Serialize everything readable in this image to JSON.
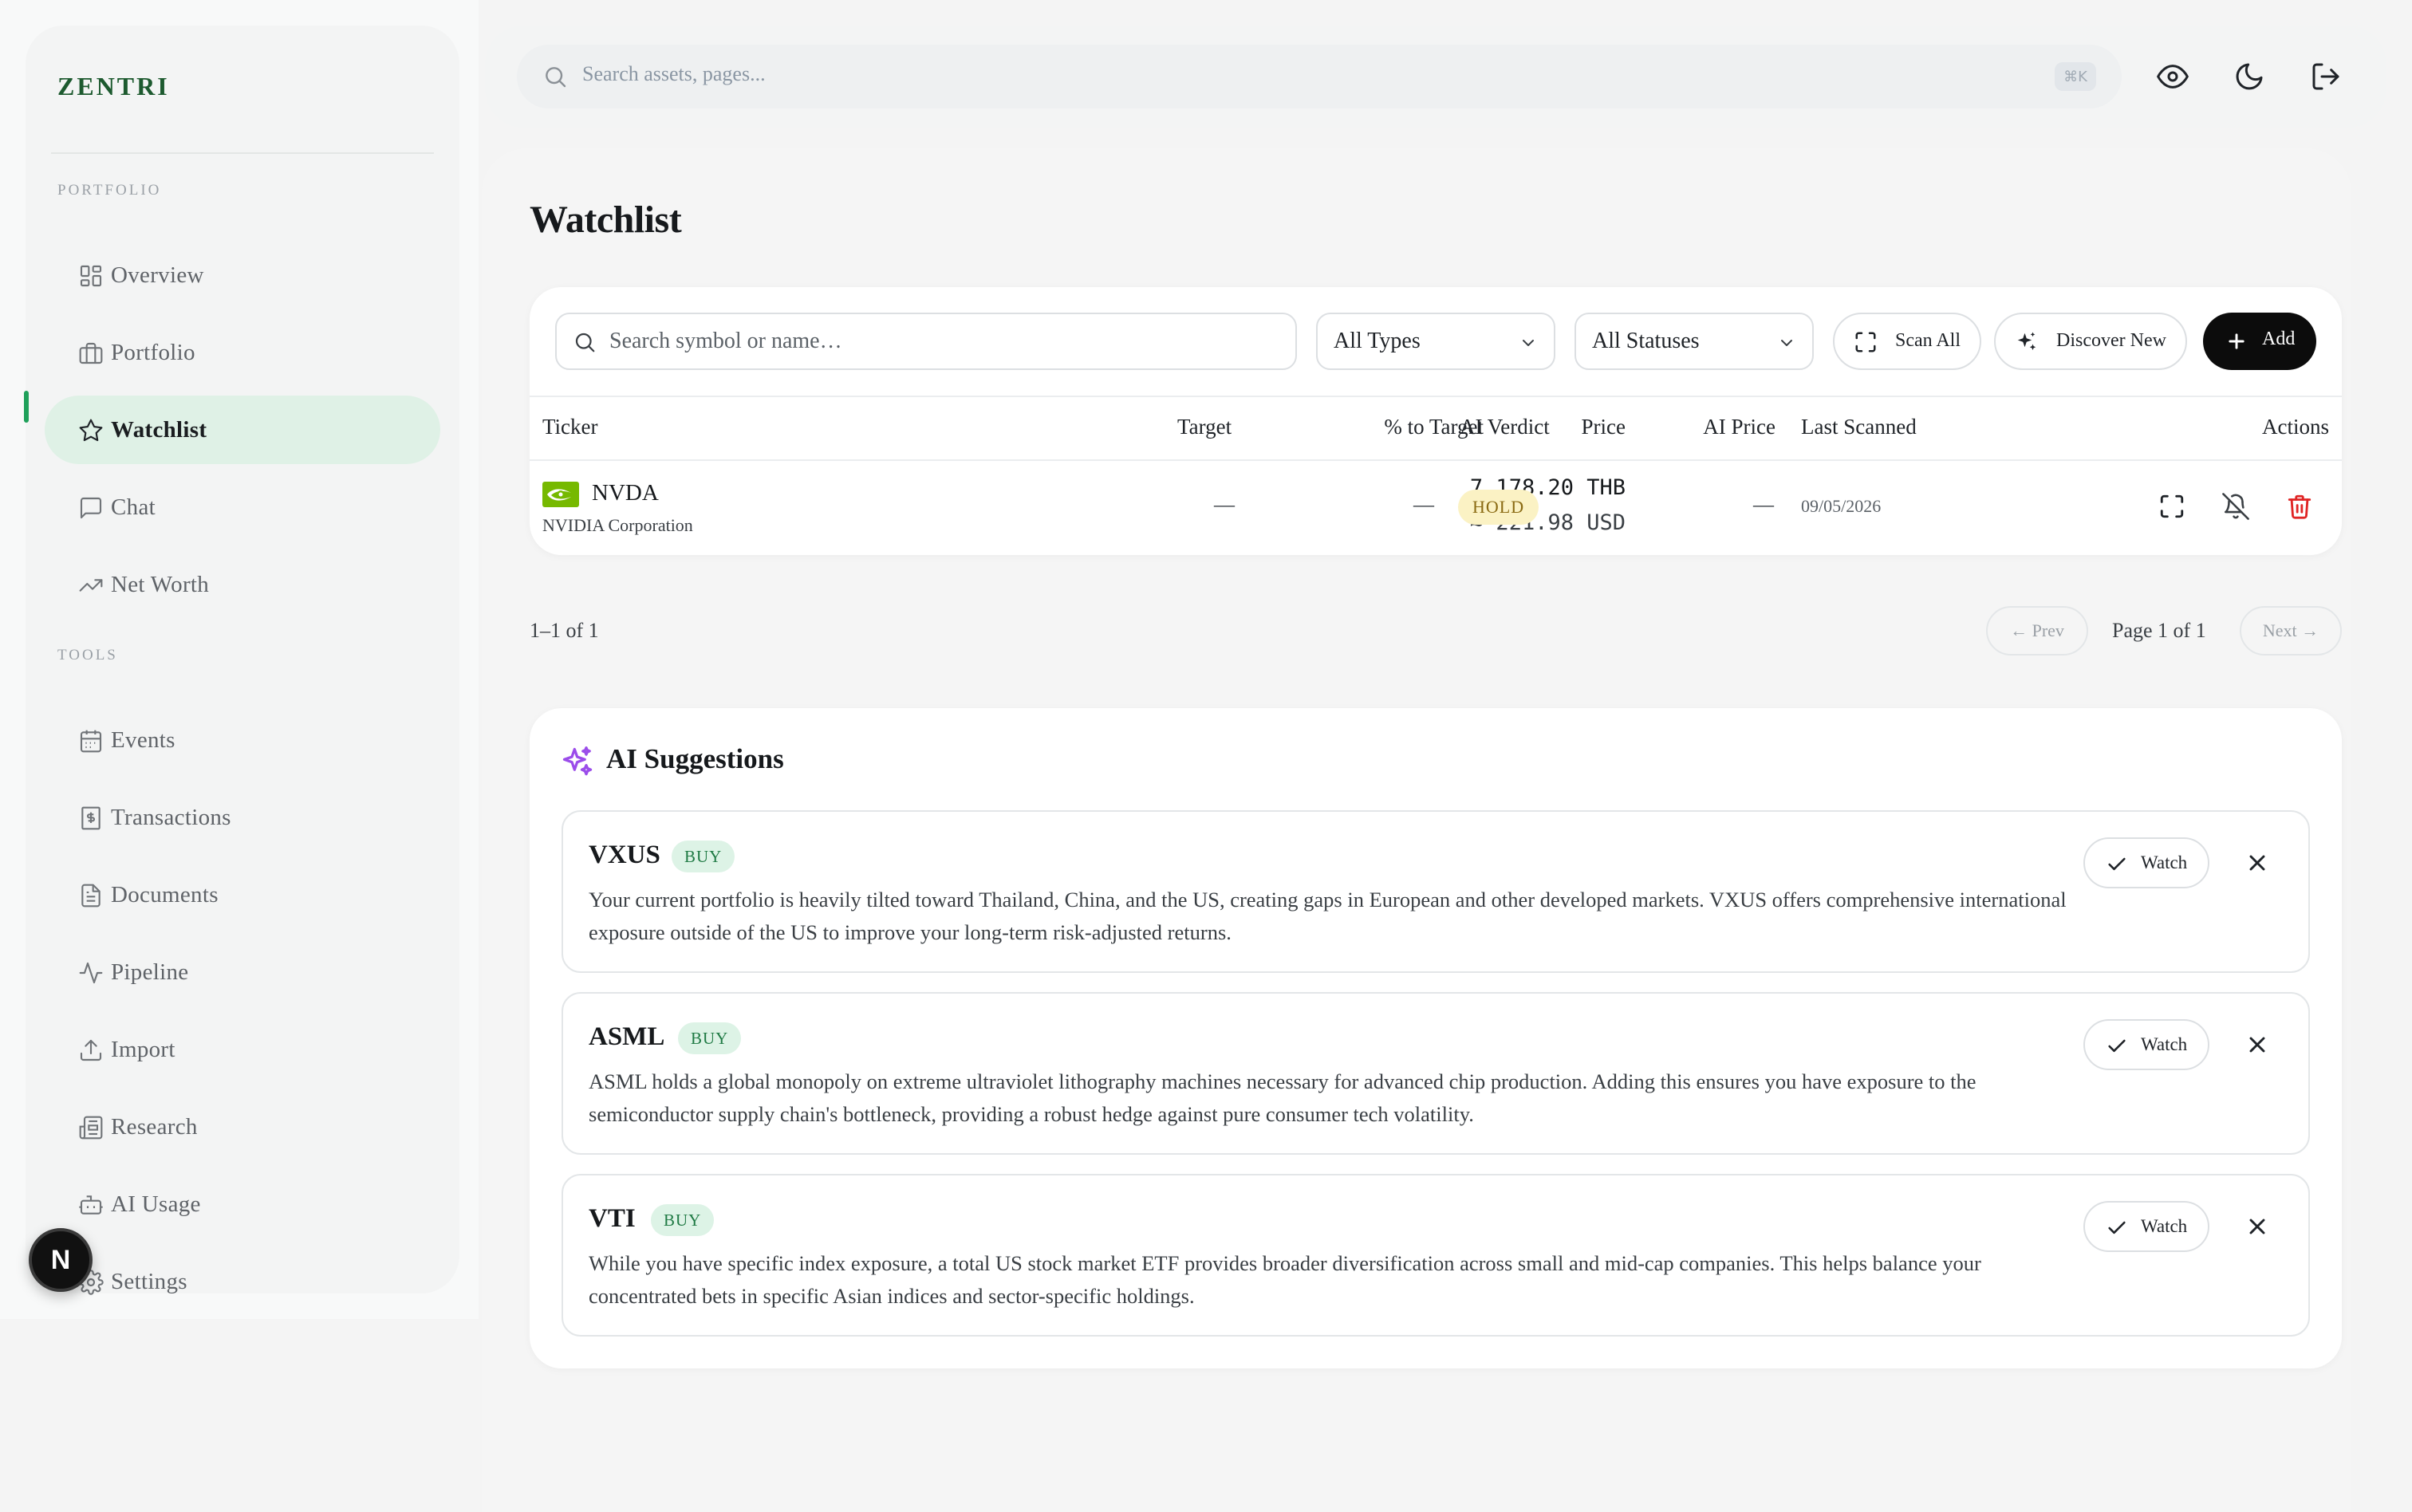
{
  "app": {
    "brand": "ZENTRI",
    "avatar_initial": "N"
  },
  "sidebar": {
    "sections": [
      {
        "label": "PORTFOLIO"
      },
      {
        "label": "TOOLS"
      }
    ],
    "items": [
      {
        "label": "Overview",
        "icon": "grid-icon"
      },
      {
        "label": "Portfolio",
        "icon": "briefcase-icon"
      },
      {
        "label": "Watchlist",
        "icon": "star-icon",
        "active": true
      },
      {
        "label": "Chat",
        "icon": "chat-icon"
      },
      {
        "label": "Net Worth",
        "icon": "trending-up-icon"
      },
      {
        "label": "Events",
        "icon": "calendar-icon"
      },
      {
        "label": "Transactions",
        "icon": "receipt-icon"
      },
      {
        "label": "Documents",
        "icon": "document-icon"
      },
      {
        "label": "Pipeline",
        "icon": "activity-icon"
      },
      {
        "label": "Import",
        "icon": "upload-icon"
      },
      {
        "label": "Research",
        "icon": "newspaper-icon"
      },
      {
        "label": "AI Usage",
        "icon": "bot-icon"
      },
      {
        "label": "Settings",
        "icon": "gear-icon"
      }
    ]
  },
  "topbar": {
    "search_placeholder": "Search assets, pages...",
    "shortcut": "⌘K"
  },
  "page": {
    "title": "Watchlist"
  },
  "filters": {
    "search_placeholder": "Search symbol or name…",
    "type_select": "All Types",
    "status_select": "All Statuses",
    "scan_all": "Scan All",
    "discover_new": "Discover New",
    "add": "Add"
  },
  "table": {
    "headers": {
      "ticker": "Ticker",
      "price": "Price",
      "target": "Target",
      "pct_to_target": "% to Target",
      "ai_verdict": "AI Verdict",
      "ai_price": "AI Price",
      "last_scanned": "Last Scanned",
      "actions": "Actions"
    },
    "rows": [
      {
        "ticker": "NVDA",
        "name": "NVIDIA Corporation",
        "price": "7,178.20 THB",
        "price_usd": "≈ 221.98 USD",
        "target": "—",
        "pct_to_target": "—",
        "ai_verdict": "HOLD",
        "ai_price": "—",
        "last_scanned": "09/05/2026"
      }
    ]
  },
  "pagination": {
    "range": "1–1 of 1",
    "prev": "← Prev",
    "page": "Page 1 of 1",
    "next": "Next →"
  },
  "ai_suggestions": {
    "title": "AI Suggestions",
    "watch_label": "Watch",
    "items": [
      {
        "symbol": "VXUS",
        "action": "BUY",
        "description": "Your current portfolio is heavily tilted toward Thailand, China, and the US, creating gaps in European and other developed markets. VXUS offers comprehensive international exposure outside of the US to improve your long-term risk-adjusted returns."
      },
      {
        "symbol": "ASML",
        "action": "BUY",
        "description": "ASML holds a global monopoly on extreme ultraviolet lithography machines necessary for advanced chip production. Adding this ensures you have exposure to the semiconductor supply chain's bottleneck, providing a robust hedge against pure consumer tech volatility."
      },
      {
        "symbol": "VTI",
        "action": "BUY",
        "description": "While you have specific index exposure, a total US stock market ETF provides broader diversification across small and mid-cap companies. This helps balance your concentrated bets in specific Asian indices and sector-specific holdings."
      }
    ]
  },
  "colors": {
    "brand": "#1d5a2f",
    "active_nav_bg": "#dff1e6",
    "active_bar": "#1fa05a",
    "hold_badge_bg": "#fbf2c4",
    "buy_badge_bg": "#ddf3e6",
    "delete": "#e02424",
    "ai_accent": "#9b4dea",
    "nvidia_green": "#76b900"
  }
}
